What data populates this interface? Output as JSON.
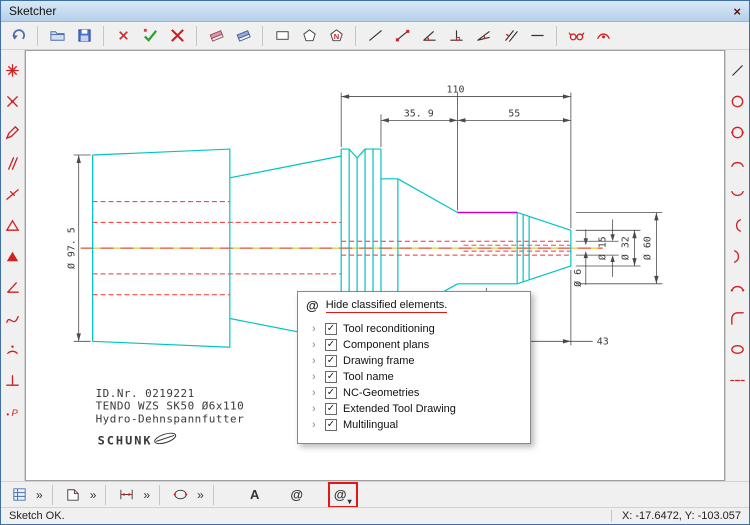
{
  "window": {
    "title": "Sketcher",
    "close_glyph": "×"
  },
  "top_toolbar": {
    "icons": [
      "undo-icon",
      "open-icon",
      "save-icon",
      "delete-icon",
      "accept-icon",
      "cancel-icon",
      "eraser-pink-icon",
      "eraser-blue-icon",
      "rectangle-tool-icon",
      "polygon-tool-icon",
      "polygon-n-tool-icon",
      "line-tool-icon",
      "line-points-tool-icon",
      "angle-line-tool-icon",
      "perpendicular-tool-icon",
      "angle-tool-icon",
      "parallel-tool-icon",
      "horizontal-line-tool-icon",
      "view-glasses-icon",
      "display-options-icon"
    ]
  },
  "left_toolbar": {
    "icons": [
      "snap-star-icon",
      "snap-point-icon",
      "sketch-pencil-icon",
      "two-lines-icon",
      "line-midpoint-icon",
      "triangle-icon",
      "triangle-filled-icon",
      "angle-icon",
      "spline-icon",
      "arc-point-icon",
      "perpendicular-icon",
      "point-p-icon"
    ]
  },
  "right_toolbar": {
    "icons": [
      "diagonal-line-icon",
      "circle-icon",
      "circle-points-icon",
      "arc-up-icon",
      "arc-down-icon",
      "arc-left-icon",
      "arc-right-icon",
      "arc-endpoints-icon",
      "fillet-icon",
      "ellipse-icon",
      "dashed-line-icon"
    ]
  },
  "canvas": {
    "dimensions": {
      "width_total": "110",
      "width_taper": "35. 9",
      "width_front": "55",
      "dia_flange": "Ø 97. 5",
      "dia_bore": "Ø 15",
      "dia_nose": "Ø 32",
      "dia_body": "Ø 60",
      "dia_clamp": "Ø 6",
      "len_back": "43"
    },
    "title_block": {
      "id_nr": "ID.Nr. 0219221",
      "designation": "TENDO WZS SK50 Ø6x110",
      "type_name": "Hydro-Dehnspannfutter",
      "brand": "SCHUNK"
    },
    "colors": {
      "geometry": "#00c4c4",
      "hidden_lines": "#f03030",
      "centerline": "#d4c400",
      "nc_geometry": "#cc00cc",
      "dimension": "#4a4a4a"
    }
  },
  "popup": {
    "icon_glyph": "@",
    "title": "Hide classified elements.",
    "expander_glyph": "›",
    "check_glyph": "✓",
    "items": [
      {
        "label": "Tool reconditioning",
        "checked": true
      },
      {
        "label": "Component plans",
        "checked": true
      },
      {
        "label": "Drawing frame",
        "checked": true
      },
      {
        "label": "Tool name",
        "checked": true
      },
      {
        "label": "NC-Geometries",
        "checked": true
      },
      {
        "label": "Extended Tool Drawing",
        "checked": true
      },
      {
        "label": "Multilingual",
        "checked": true
      }
    ]
  },
  "bottom_toolbar": {
    "icons": [
      "views-icon",
      "contour-select-icon",
      "dimension-icon",
      "ellipse-icon",
      "text-tool-icon",
      "at-icon",
      "classified-at-icon"
    ],
    "chevron": "»",
    "text_tool_label": "A",
    "at_label": "@",
    "classified_at_label": "@",
    "dropdown_glyph": "▾"
  },
  "status": {
    "left": "Sketch OK.",
    "right": "X: -17.6472, Y: -103.057"
  }
}
